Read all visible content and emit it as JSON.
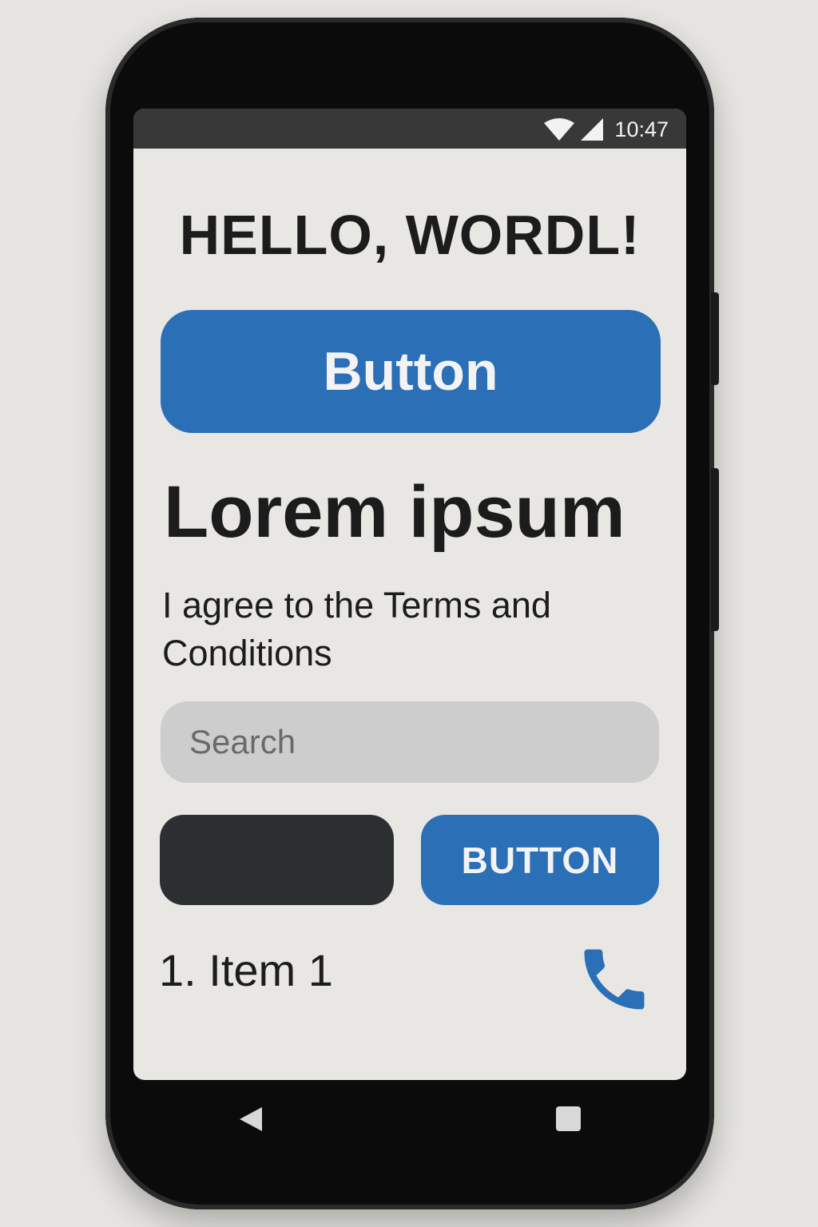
{
  "status_bar": {
    "time": "10:47",
    "icons": [
      "wifi-icon",
      "signal-icon"
    ]
  },
  "main": {
    "title": "HELLO, WORDL!",
    "primary_button_label": "Button",
    "heading": "Lorem ipsum",
    "terms_text": "I agree to the Terms and Conditions",
    "search": {
      "placeholder": "Search",
      "value": ""
    },
    "dark_button_label": "",
    "secondary_button_label": "BUTTON",
    "list": {
      "items": [
        {
          "label": "1. Item 1",
          "icon": "phone-icon"
        }
      ]
    }
  },
  "nav_bar": {
    "icons": [
      "back-icon",
      "recents-icon"
    ]
  },
  "colors": {
    "accent": "#2b6fb7",
    "dark_button": "#2c2f32",
    "screen_background": "#e8e7e3",
    "status_bar": "#383838",
    "search_background": "#cdcdcd"
  }
}
